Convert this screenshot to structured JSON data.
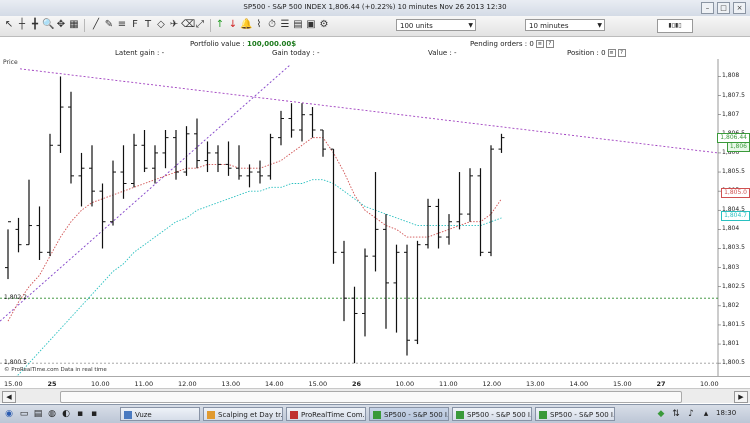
{
  "window": {
    "title": "SP500 - S&P 500 INDEX   1,806.44 (+0.22%)   10 minutes  Nov 26 2013 12:30"
  },
  "toolbar": {
    "units_select": "100 units",
    "period_select": "10 minutes"
  },
  "info": {
    "portfolio_label": "Portfolio value :",
    "portfolio_value": "100,000.00$",
    "pending_label": "Pending orders : 0",
    "latent_label": "Latent gain :",
    "latent_value": "-",
    "gain_today_label": "Gain today :",
    "gain_today_value": "-",
    "value_label": "Value :",
    "value_value": "-",
    "position_label": "Position : 0"
  },
  "chart": {
    "price_label": "Price",
    "credit": "© ProRealTime.com  Data in real time",
    "left_levels": [
      "1,802.2",
      "1,800.5"
    ],
    "price_boxes": [
      {
        "text": "1,806.44",
        "color": "#3a9a3a"
      },
      {
        "text": "1,806",
        "color": "#3a9a3a"
      },
      {
        "text": "1,805.0",
        "color": "#d05050"
      },
      {
        "text": "1,804.7",
        "color": "#2ac0c0"
      }
    ]
  },
  "chart_data": {
    "type": "candlestick",
    "title": "SP500 - S&P 500 INDEX",
    "y_ticks": [
      "1,808",
      "1,807.5",
      "1,807",
      "1,806.5",
      "1,806",
      "1,805.5",
      "1,805",
      "1,804.5",
      "1,804",
      "1,803.5",
      "1,803",
      "1,802.5",
      "1,802",
      "1,801.5",
      "1,801",
      "1,800.5"
    ],
    "ylim": [
      1800.4,
      1808.3
    ],
    "x_ticks": [
      "15.00",
      "25",
      "10.00",
      "11.00",
      "12.00",
      "13.00",
      "14.00",
      "15.00",
      "26",
      "10.00",
      "11.00",
      "12.00",
      "13.00",
      "14.00",
      "15.00",
      "27",
      "10.00"
    ],
    "candles": [
      [
        1803.0,
        1804.0,
        1802.7,
        1804.2
      ],
      [
        1804.0,
        1804.3,
        1803.4,
        1803.6
      ],
      [
        1803.6,
        1805.3,
        1803.6,
        1804.1
      ],
      [
        1804.1,
        1804.6,
        1803.2,
        1803.4
      ],
      [
        1803.4,
        1806.5,
        1803.3,
        1806.2
      ],
      [
        1806.2,
        1808.0,
        1806.0,
        1807.2
      ],
      [
        1807.2,
        1807.6,
        1805.2,
        1805.4
      ],
      [
        1805.4,
        1806.0,
        1804.6,
        1805.6
      ],
      [
        1805.6,
        1806.2,
        1804.6,
        1805.0
      ],
      [
        1805.0,
        1805.2,
        1803.5,
        1804.2
      ],
      [
        1804.2,
        1805.8,
        1804.1,
        1805.5
      ],
      [
        1805.5,
        1806.2,
        1804.8,
        1805.2
      ],
      [
        1805.2,
        1806.5,
        1805.1,
        1806.2
      ],
      [
        1806.2,
        1806.6,
        1805.5,
        1805.6
      ],
      [
        1805.6,
        1806.2,
        1805.2,
        1806.0
      ],
      [
        1806.0,
        1806.6,
        1805.6,
        1806.4
      ],
      [
        1806.4,
        1806.6,
        1805.3,
        1805.5
      ],
      [
        1805.5,
        1806.7,
        1805.4,
        1806.5
      ],
      [
        1806.5,
        1806.9,
        1805.6,
        1805.8
      ],
      [
        1805.8,
        1806.3,
        1805.5,
        1806.0
      ],
      [
        1806.0,
        1806.2,
        1805.5,
        1805.7
      ],
      [
        1805.7,
        1806.3,
        1805.4,
        1805.6
      ],
      [
        1805.6,
        1806.2,
        1805.3,
        1805.4
      ],
      [
        1805.4,
        1805.7,
        1805.1,
        1805.5
      ],
      [
        1805.5,
        1805.8,
        1805.2,
        1805.4
      ],
      [
        1805.4,
        1806.5,
        1805.3,
        1806.4
      ],
      [
        1806.4,
        1807.1,
        1806.2,
        1806.9
      ],
      [
        1806.9,
        1807.3,
        1806.4,
        1806.6
      ],
      [
        1806.6,
        1807.3,
        1806.3,
        1807.0
      ],
      [
        1807.0,
        1807.2,
        1806.4,
        1806.6
      ],
      [
        1806.6,
        1806.6,
        1805.9,
        1806.1
      ],
      [
        1806.1,
        1806.1,
        1803.1,
        1803.4
      ],
      [
        1803.4,
        1803.7,
        1801.6,
        1802.2
      ],
      [
        1802.2,
        1802.5,
        1800.5,
        1801.8
      ],
      [
        1801.8,
        1803.5,
        1801.2,
        1803.3
      ],
      [
        1803.3,
        1805.5,
        1802.9,
        1804.0
      ],
      [
        1804.0,
        1804.4,
        1801.4,
        1802.6
      ],
      [
        1802.6,
        1803.6,
        1801.3,
        1803.4
      ],
      [
        1803.4,
        1803.6,
        1800.7,
        1801.1
      ],
      [
        1801.1,
        1803.7,
        1801.0,
        1803.6
      ],
      [
        1803.6,
        1804.8,
        1803.5,
        1804.6
      ],
      [
        1804.6,
        1804.8,
        1803.5,
        1803.8
      ],
      [
        1803.8,
        1804.4,
        1803.6,
        1804.2
      ],
      [
        1804.2,
        1805.5,
        1804.0,
        1804.4
      ],
      [
        1804.4,
        1805.6,
        1804.2,
        1805.4
      ],
      [
        1805.4,
        1805.6,
        1803.3,
        1803.4
      ],
      [
        1803.4,
        1806.2,
        1803.3,
        1806.1
      ],
      [
        1806.1,
        1806.5,
        1806.0,
        1806.4
      ]
    ],
    "moving_averages": [
      {
        "color": "#d05050",
        "values": [
          1801.6,
          1802.1,
          1802.5,
          1802.8,
          1803.3,
          1803.8,
          1804.2,
          1804.5,
          1804.7,
          1804.8,
          1804.9,
          1805.0,
          1805.1,
          1805.2,
          1805.3,
          1805.4,
          1805.5,
          1805.6,
          1805.6,
          1805.7,
          1805.7,
          1805.7,
          1805.6,
          1805.6,
          1805.6,
          1805.7,
          1805.8,
          1806.0,
          1806.2,
          1806.4,
          1806.4,
          1806.0,
          1805.5,
          1804.9,
          1804.5,
          1804.3,
          1804.1,
          1804.0,
          1803.8,
          1803.8,
          1803.8,
          1803.9,
          1804.0,
          1804.1,
          1804.2,
          1804.2,
          1804.4,
          1804.8
        ]
      },
      {
        "color": "#2ac0c0",
        "values": [
          1800.0,
          1800.2,
          1800.5,
          1800.8,
          1801.1,
          1801.4,
          1801.7,
          1802.0,
          1802.3,
          1802.6,
          1802.9,
          1803.1,
          1803.4,
          1803.6,
          1803.8,
          1804.0,
          1804.2,
          1804.3,
          1804.5,
          1804.6,
          1804.7,
          1804.8,
          1804.9,
          1805.0,
          1805.0,
          1805.1,
          1805.1,
          1805.2,
          1805.2,
          1805.3,
          1805.3,
          1805.2,
          1805.0,
          1804.8,
          1804.6,
          1804.5,
          1804.4,
          1804.3,
          1804.2,
          1804.1,
          1804.1,
          1804.1,
          1804.1,
          1804.1,
          1804.1,
          1804.1,
          1804.2,
          1804.3
        ]
      }
    ],
    "horizontal_levels": [
      1802.2,
      1800.5
    ]
  },
  "taskbar": {
    "items": [
      "Vuze",
      "Scalping et Day tr...",
      "ProRealTime Com...",
      "SP500 - S&P 500 I...",
      "SP500 - S&P 500 I...",
      "SP500 - S&P 500 I..."
    ],
    "clock": "18:30"
  }
}
